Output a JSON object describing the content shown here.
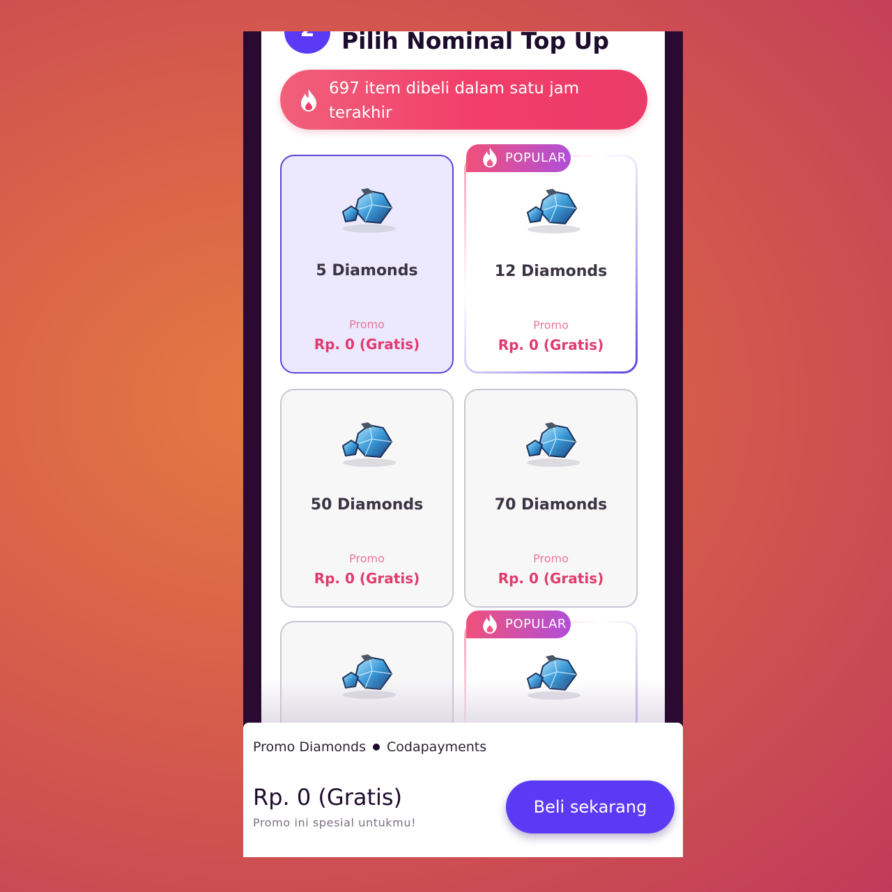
{
  "section": {
    "step_number": "2",
    "title": "Pilih Nominal Top Up"
  },
  "hot_banner": {
    "icon": "flame-icon",
    "text": "697 item dibeli dalam satu jam terakhir"
  },
  "badge_label": "POPULAR",
  "items": [
    {
      "title": "5 Diamonds",
      "promo": "Promo",
      "price": "Rp. 0 (Gratis)",
      "selected": true,
      "popular": false
    },
    {
      "title": "12 Diamonds",
      "promo": "Promo",
      "price": "Rp. 0 (Gratis)",
      "selected": false,
      "popular": true
    },
    {
      "title": "50 Diamonds",
      "promo": "Promo",
      "price": "Rp. 0 (Gratis)",
      "selected": false,
      "popular": false
    },
    {
      "title": "70 Diamonds",
      "promo": "Promo",
      "price": "Rp. 0 (Gratis)",
      "selected": false,
      "popular": false
    },
    {
      "title": "",
      "promo": "",
      "price": "",
      "selected": false,
      "popular": false
    },
    {
      "title": "",
      "promo": "",
      "price": "",
      "selected": false,
      "popular": true
    }
  ],
  "footer": {
    "product": "Promo Diamonds",
    "provider": "Codapayments",
    "price": "Rp. 0 (Gratis)",
    "subtitle": "Promo ini spesial untukmu!",
    "buy_label": "Beli sekarang"
  },
  "colors": {
    "accent": "#5b3af5",
    "price_pink": "#e23a6e",
    "banner": "#f23d6a"
  }
}
